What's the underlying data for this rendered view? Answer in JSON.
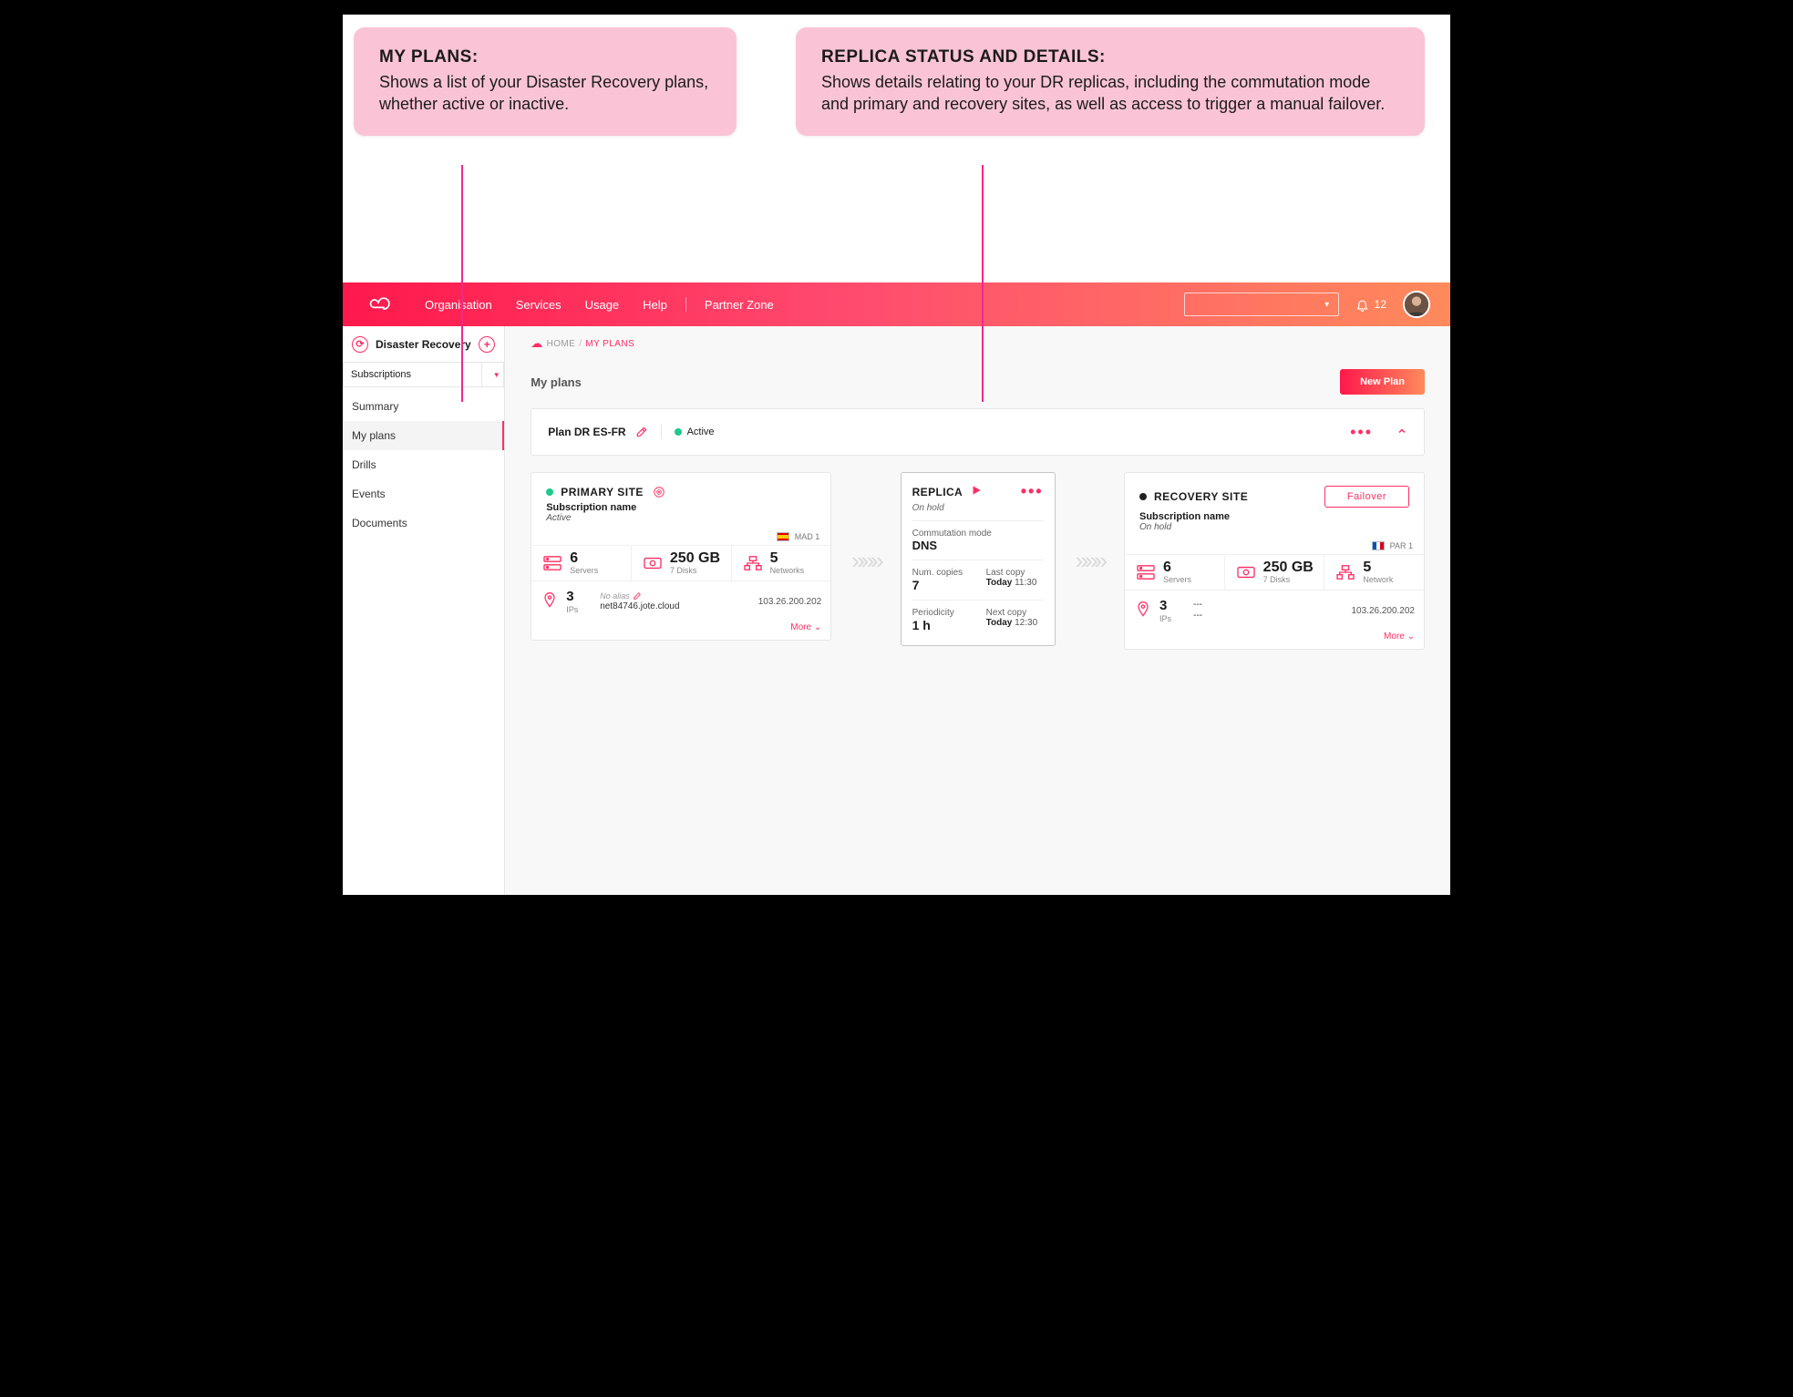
{
  "callouts": {
    "left": {
      "title": "MY PLANS:",
      "body": "Shows a list of your Disaster Recovery plans, whether active or inactive."
    },
    "right": {
      "title": "REPLICA STATUS AND DETAILS:",
      "body": "Shows details relating to your DR replicas, including the commutation mode and primary and recovery sites, as well as access to trigger a manual failover."
    }
  },
  "topnav": {
    "items": [
      "Organisation",
      "Services",
      "Usage",
      "Help"
    ],
    "partner": "Partner Zone",
    "notif_count": "12"
  },
  "sidebar": {
    "title": "Disaster Recovery",
    "selector": "Subscriptions",
    "items": [
      "Summary",
      "My plans",
      "Drills",
      "Events",
      "Documents"
    ],
    "active_index": 1
  },
  "crumbs": {
    "home": "HOME",
    "current": "MY PLANS"
  },
  "page": {
    "title": "My plans",
    "new_btn": "New Plan",
    "plan_name": "Plan DR ES-FR",
    "status_label": "Active"
  },
  "primary": {
    "heading": "PRIMARY SITE",
    "sub_label": "Subscription name",
    "status": "Active",
    "region": "MAD 1",
    "servers": {
      "value": "6",
      "label": "Servers"
    },
    "storage": {
      "value": "250 GB",
      "label": "7 Disks"
    },
    "networks": {
      "value": "5",
      "label": "Networks"
    },
    "ips": {
      "value": "3",
      "label": "IPs"
    },
    "alias_label": "No alias",
    "alias_host": "net84746.jote.cloud",
    "ip_addr": "103.26.200.202",
    "more": "More"
  },
  "replica": {
    "heading": "REPLICA",
    "status": "On hold",
    "mode_label": "Commutation mode",
    "mode": "DNS",
    "copies_label": "Num. copies",
    "copies": "7",
    "last_label": "Last copy",
    "last_day": "Today",
    "last_time": "11:30",
    "period_label": "Periodicity",
    "period": "1 h",
    "next_label": "Next copy",
    "next_day": "Today",
    "next_time": "12:30"
  },
  "recovery": {
    "heading": "RECOVERY SITE",
    "btn": "Failover",
    "sub_label": "Subscription name",
    "status": "On hold",
    "region": "PAR 1",
    "servers": {
      "value": "6",
      "label": "Servers"
    },
    "storage": {
      "value": "250 GB",
      "label": "7 Disks"
    },
    "networks": {
      "value": "5",
      "label": "Network"
    },
    "ips": {
      "value": "3",
      "label": "IPs"
    },
    "alias_top": "---",
    "alias_host": "---",
    "ip_addr": "103.26.200.202",
    "more": "More"
  }
}
